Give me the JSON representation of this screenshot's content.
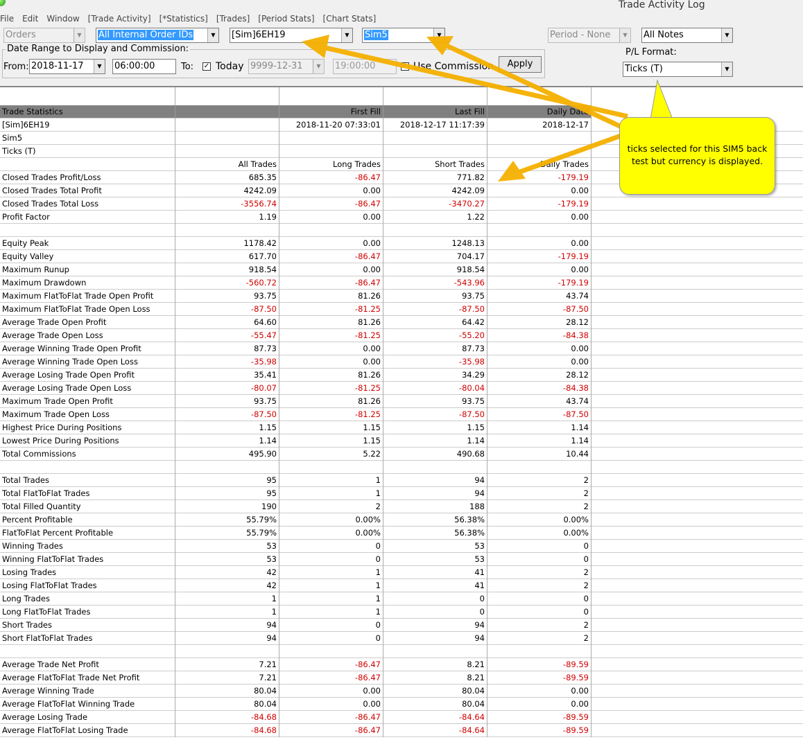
{
  "window": {
    "title": "Trade Activity Log"
  },
  "menu": [
    "File",
    "Edit",
    "Window",
    "[Trade Activity]",
    "[*Statistics]",
    "[Trades]",
    "[Period Stats]",
    "[Chart Stats]"
  ],
  "filters": {
    "orders": "Orders",
    "order_ids": "All Internal Order IDs",
    "symbol": "[Sim]6EH19",
    "account": "Sim5",
    "period": "Period - None",
    "notes": "All Notes"
  },
  "date_range": {
    "group_label": "Date Range to Display and Commission:",
    "from_label": "From:",
    "from_date": "2018-11-17",
    "from_time": "06:00:00",
    "to_label": "To:",
    "today_label": "Today",
    "today_checked": true,
    "to_date": "9999-12-31",
    "to_time": "19:00:00",
    "use_commission_label": "Use Commission",
    "use_commission_checked": true,
    "apply_label": "Apply"
  },
  "pl_format": {
    "label": "P/L Format:",
    "value": "Ticks (T)"
  },
  "callout": {
    "text": "ticks selected for this SIM5 back test but currency is displayed."
  },
  "colors": {
    "negative": "#d00000",
    "arrow": "#f5b000",
    "callout": "#ffff00"
  },
  "table": {
    "header": [
      "Trade Statistics",
      "",
      "First Fill",
      "Last Fill",
      "Daily Date"
    ],
    "rows": [
      [
        "[Sim]6EH19",
        "",
        "2018-11-20  07:33:01",
        "2018-12-17  11:17:39",
        "2018-12-17"
      ],
      [
        "Sim5",
        "",
        "",
        "",
        ""
      ],
      [
        "Ticks (T)",
        "",
        "",
        "",
        ""
      ],
      [
        "",
        "All Trades",
        "Long Trades",
        "Short Trades",
        "Daily Trades"
      ],
      [
        "Closed Trades Profit/Loss",
        "685.35",
        "-86.47",
        "771.82",
        "-179.19"
      ],
      [
        "Closed Trades Total Profit",
        "4242.09",
        "0.00",
        "4242.09",
        "0.00"
      ],
      [
        "Closed Trades Total Loss",
        "-3556.74",
        "-86.47",
        "-3470.27",
        "-179.19"
      ],
      [
        "Profit Factor",
        "1.19",
        "0.00",
        "1.22",
        "0.00"
      ],
      [
        "",
        "",
        "",
        "",
        ""
      ],
      [
        "Equity Peak",
        "1178.42",
        "0.00",
        "1248.13",
        "0.00"
      ],
      [
        "Equity Valley",
        "617.70",
        "-86.47",
        "704.17",
        "-179.19"
      ],
      [
        "Maximum Runup",
        "918.54",
        "0.00",
        "918.54",
        "0.00"
      ],
      [
        "Maximum Drawdown",
        "-560.72",
        "-86.47",
        "-543.96",
        "-179.19"
      ],
      [
        "Maximum FlatToFlat Trade Open Profit",
        "93.75",
        "81.26",
        "93.75",
        "43.74"
      ],
      [
        "Maximum FlatToFlat Trade Open Loss",
        "-87.50",
        "-81.25",
        "-87.50",
        "-87.50"
      ],
      [
        "Average Trade Open Profit",
        "64.60",
        "81.26",
        "64.42",
        "28.12"
      ],
      [
        "Average Trade Open Loss",
        "-55.47",
        "-81.25",
        "-55.20",
        "-84.38"
      ],
      [
        "Average Winning Trade Open Profit",
        "87.73",
        "0.00",
        "87.73",
        "0.00"
      ],
      [
        "Average Winning Trade Open Loss",
        "-35.98",
        "0.00",
        "-35.98",
        "0.00"
      ],
      [
        "Average Losing Trade Open Profit",
        "35.41",
        "81.26",
        "34.29",
        "28.12"
      ],
      [
        "Average Losing Trade Open Loss",
        "-80.07",
        "-81.25",
        "-80.04",
        "-84.38"
      ],
      [
        "Maximum Trade Open Profit",
        "93.75",
        "81.26",
        "93.75",
        "43.74"
      ],
      [
        "Maximum Trade Open Loss",
        "-87.50",
        "-81.25",
        "-87.50",
        "-87.50"
      ],
      [
        "Highest Price During Positions",
        "1.15",
        "1.15",
        "1.15",
        "1.14"
      ],
      [
        "Lowest Price During Positions",
        "1.14",
        "1.15",
        "1.14",
        "1.14"
      ],
      [
        "Total Commissions",
        "495.90",
        "5.22",
        "490.68",
        "10.44"
      ],
      [
        "",
        "",
        "",
        "",
        ""
      ],
      [
        "Total Trades",
        "95",
        "1",
        "94",
        "2"
      ],
      [
        "Total FlatToFlat Trades",
        "95",
        "1",
        "94",
        "2"
      ],
      [
        "Total Filled Quantity",
        "190",
        "2",
        "188",
        "2"
      ],
      [
        "Percent Profitable",
        "55.79%",
        "0.00%",
        "56.38%",
        "0.00%"
      ],
      [
        "FlatToFlat Percent Profitable",
        "55.79%",
        "0.00%",
        "56.38%",
        "0.00%"
      ],
      [
        "Winning Trades",
        "53",
        "0",
        "53",
        "0"
      ],
      [
        "Winning FlatToFlat Trades",
        "53",
        "0",
        "53",
        "0"
      ],
      [
        "Losing Trades",
        "42",
        "1",
        "41",
        "2"
      ],
      [
        "Losing FlatToFlat Trades",
        "42",
        "1",
        "41",
        "2"
      ],
      [
        "Long Trades",
        "1",
        "1",
        "0",
        "0"
      ],
      [
        "Long FlatToFlat Trades",
        "1",
        "1",
        "0",
        "0"
      ],
      [
        "Short Trades",
        "94",
        "0",
        "94",
        "2"
      ],
      [
        "Short FlatToFlat Trades",
        "94",
        "0",
        "94",
        "2"
      ],
      [
        "",
        "",
        "",
        "",
        ""
      ],
      [
        "Average Trade Net Profit",
        "7.21",
        "-86.47",
        "8.21",
        "-89.59"
      ],
      [
        "Average FlatToFlat Trade Net Profit",
        "7.21",
        "-86.47",
        "8.21",
        "-89.59"
      ],
      [
        "Average Winning Trade",
        "80.04",
        "0.00",
        "80.04",
        "0.00"
      ],
      [
        "Average FlatToFlat Winning Trade",
        "80.04",
        "0.00",
        "80.04",
        "0.00"
      ],
      [
        "Average Losing Trade",
        "-84.68",
        "-86.47",
        "-84.64",
        "-89.59"
      ],
      [
        "Average FlatToFlat Losing Trade",
        "-84.68",
        "-86.47",
        "-84.64",
        "-89.59"
      ]
    ]
  }
}
